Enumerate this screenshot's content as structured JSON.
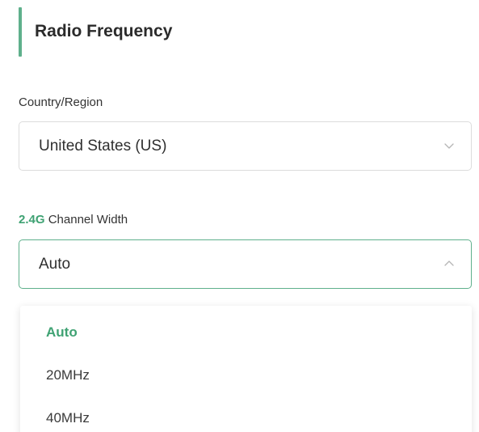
{
  "section": {
    "title": "Radio Frequency"
  },
  "country_region": {
    "label": "Country/Region",
    "value": "United States (US)",
    "icon": "chevron-down-icon",
    "open": false
  },
  "channel_width": {
    "label_accent": "2.4G",
    "label_text": "Channel Width",
    "value": "Auto",
    "icon": "chevron-up-icon",
    "open": true,
    "options": [
      {
        "label": "Auto",
        "selected": true
      },
      {
        "label": "20MHz",
        "selected": false
      },
      {
        "label": "40MHz",
        "selected": false
      }
    ]
  },
  "colors": {
    "accent": "#5fb08c",
    "accent_text": "#3fa273",
    "border": "#dcdcdc"
  }
}
